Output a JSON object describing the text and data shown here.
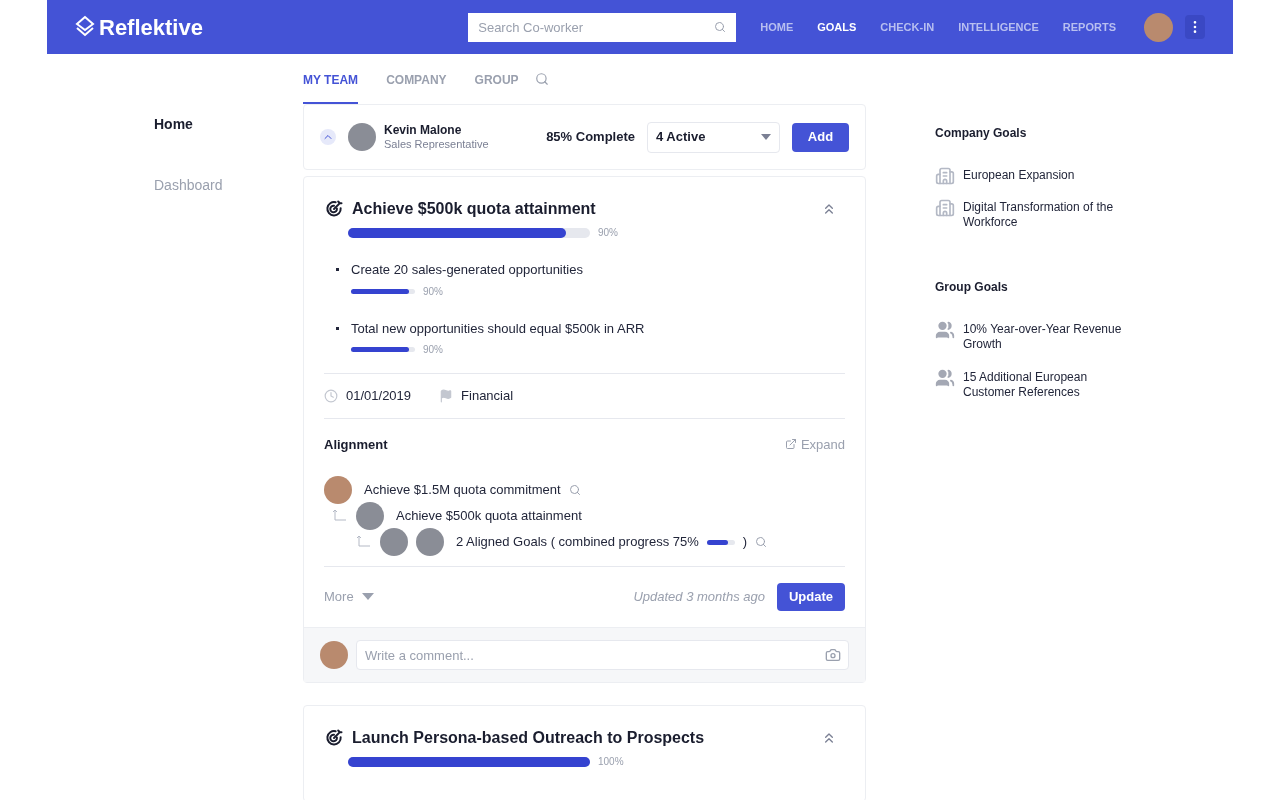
{
  "header": {
    "logo": "Reflektive",
    "search": {
      "placeholder": "Search Co-worker"
    },
    "nav": [
      {
        "label": "HOME",
        "selected": false
      },
      {
        "label": "GOALS",
        "selected": true
      },
      {
        "label": "CHECK-IN",
        "selected": false
      },
      {
        "label": "INTELLIGENCE",
        "selected": false
      },
      {
        "label": "REPORTS",
        "selected": false
      }
    ]
  },
  "tabs": [
    {
      "label": "MY TEAM",
      "selected": true
    },
    {
      "label": "COMPANY",
      "selected": false
    },
    {
      "label": "GROUP",
      "selected": false
    }
  ],
  "sidebar": {
    "items": [
      {
        "label": "Home",
        "selected": true
      },
      {
        "label": "Dashboard",
        "selected": false
      }
    ]
  },
  "member": {
    "name": "Kevin Malone",
    "role": "Sales Representative",
    "expanded": true,
    "completion": "85% Complete",
    "filter": "4 Active",
    "add_button": "Add"
  },
  "goals": [
    {
      "title": "Achieve $500k quota attainment",
      "level": 0.9,
      "percent": "90%",
      "expanded": true,
      "key_results": [
        {
          "title": "Create 20 sales-generated opportunities",
          "level": 0.9,
          "percent": "90%"
        },
        {
          "title": "Total new opportunities should equal $500k in ARR",
          "level": 0.9,
          "percent": "90%"
        }
      ],
      "date": "01/01/2019",
      "category": "Financial",
      "alignment": {
        "heading": "Alignment",
        "expand": "Expand",
        "tree": [
          {
            "kind": "goal",
            "title": "Achieve $1.5M quota commitment",
            "searchable": true,
            "children": [
              {
                "kind": "goal",
                "title": "Achieve $500k quota attainment",
                "searchable": false,
                "children": [
                  {
                    "kind": "group",
                    "title": "2 Aligned Goals ( combined progress 75%",
                    "level": 0.75,
                    "suffix": ")",
                    "searchable": true
                  }
                ]
              }
            ]
          }
        ]
      },
      "more": "More",
      "updated": "Updated 3 months ago",
      "update_button": "Update",
      "comment_placeholder": "Write a comment..."
    },
    {
      "title": "Launch Persona-based Outreach to Prospects",
      "level": 1,
      "percent": "100%",
      "expanded": true
    }
  ],
  "company_goals": {
    "heading": "Company Goals",
    "items": [
      "European Expansion",
      "Digital Transformation of the Workforce"
    ]
  },
  "group_goals": {
    "heading": "Group Goals",
    "items": [
      "10% Year-over-Year Revenue Growth",
      "15 Additional European Customer References"
    ]
  }
}
